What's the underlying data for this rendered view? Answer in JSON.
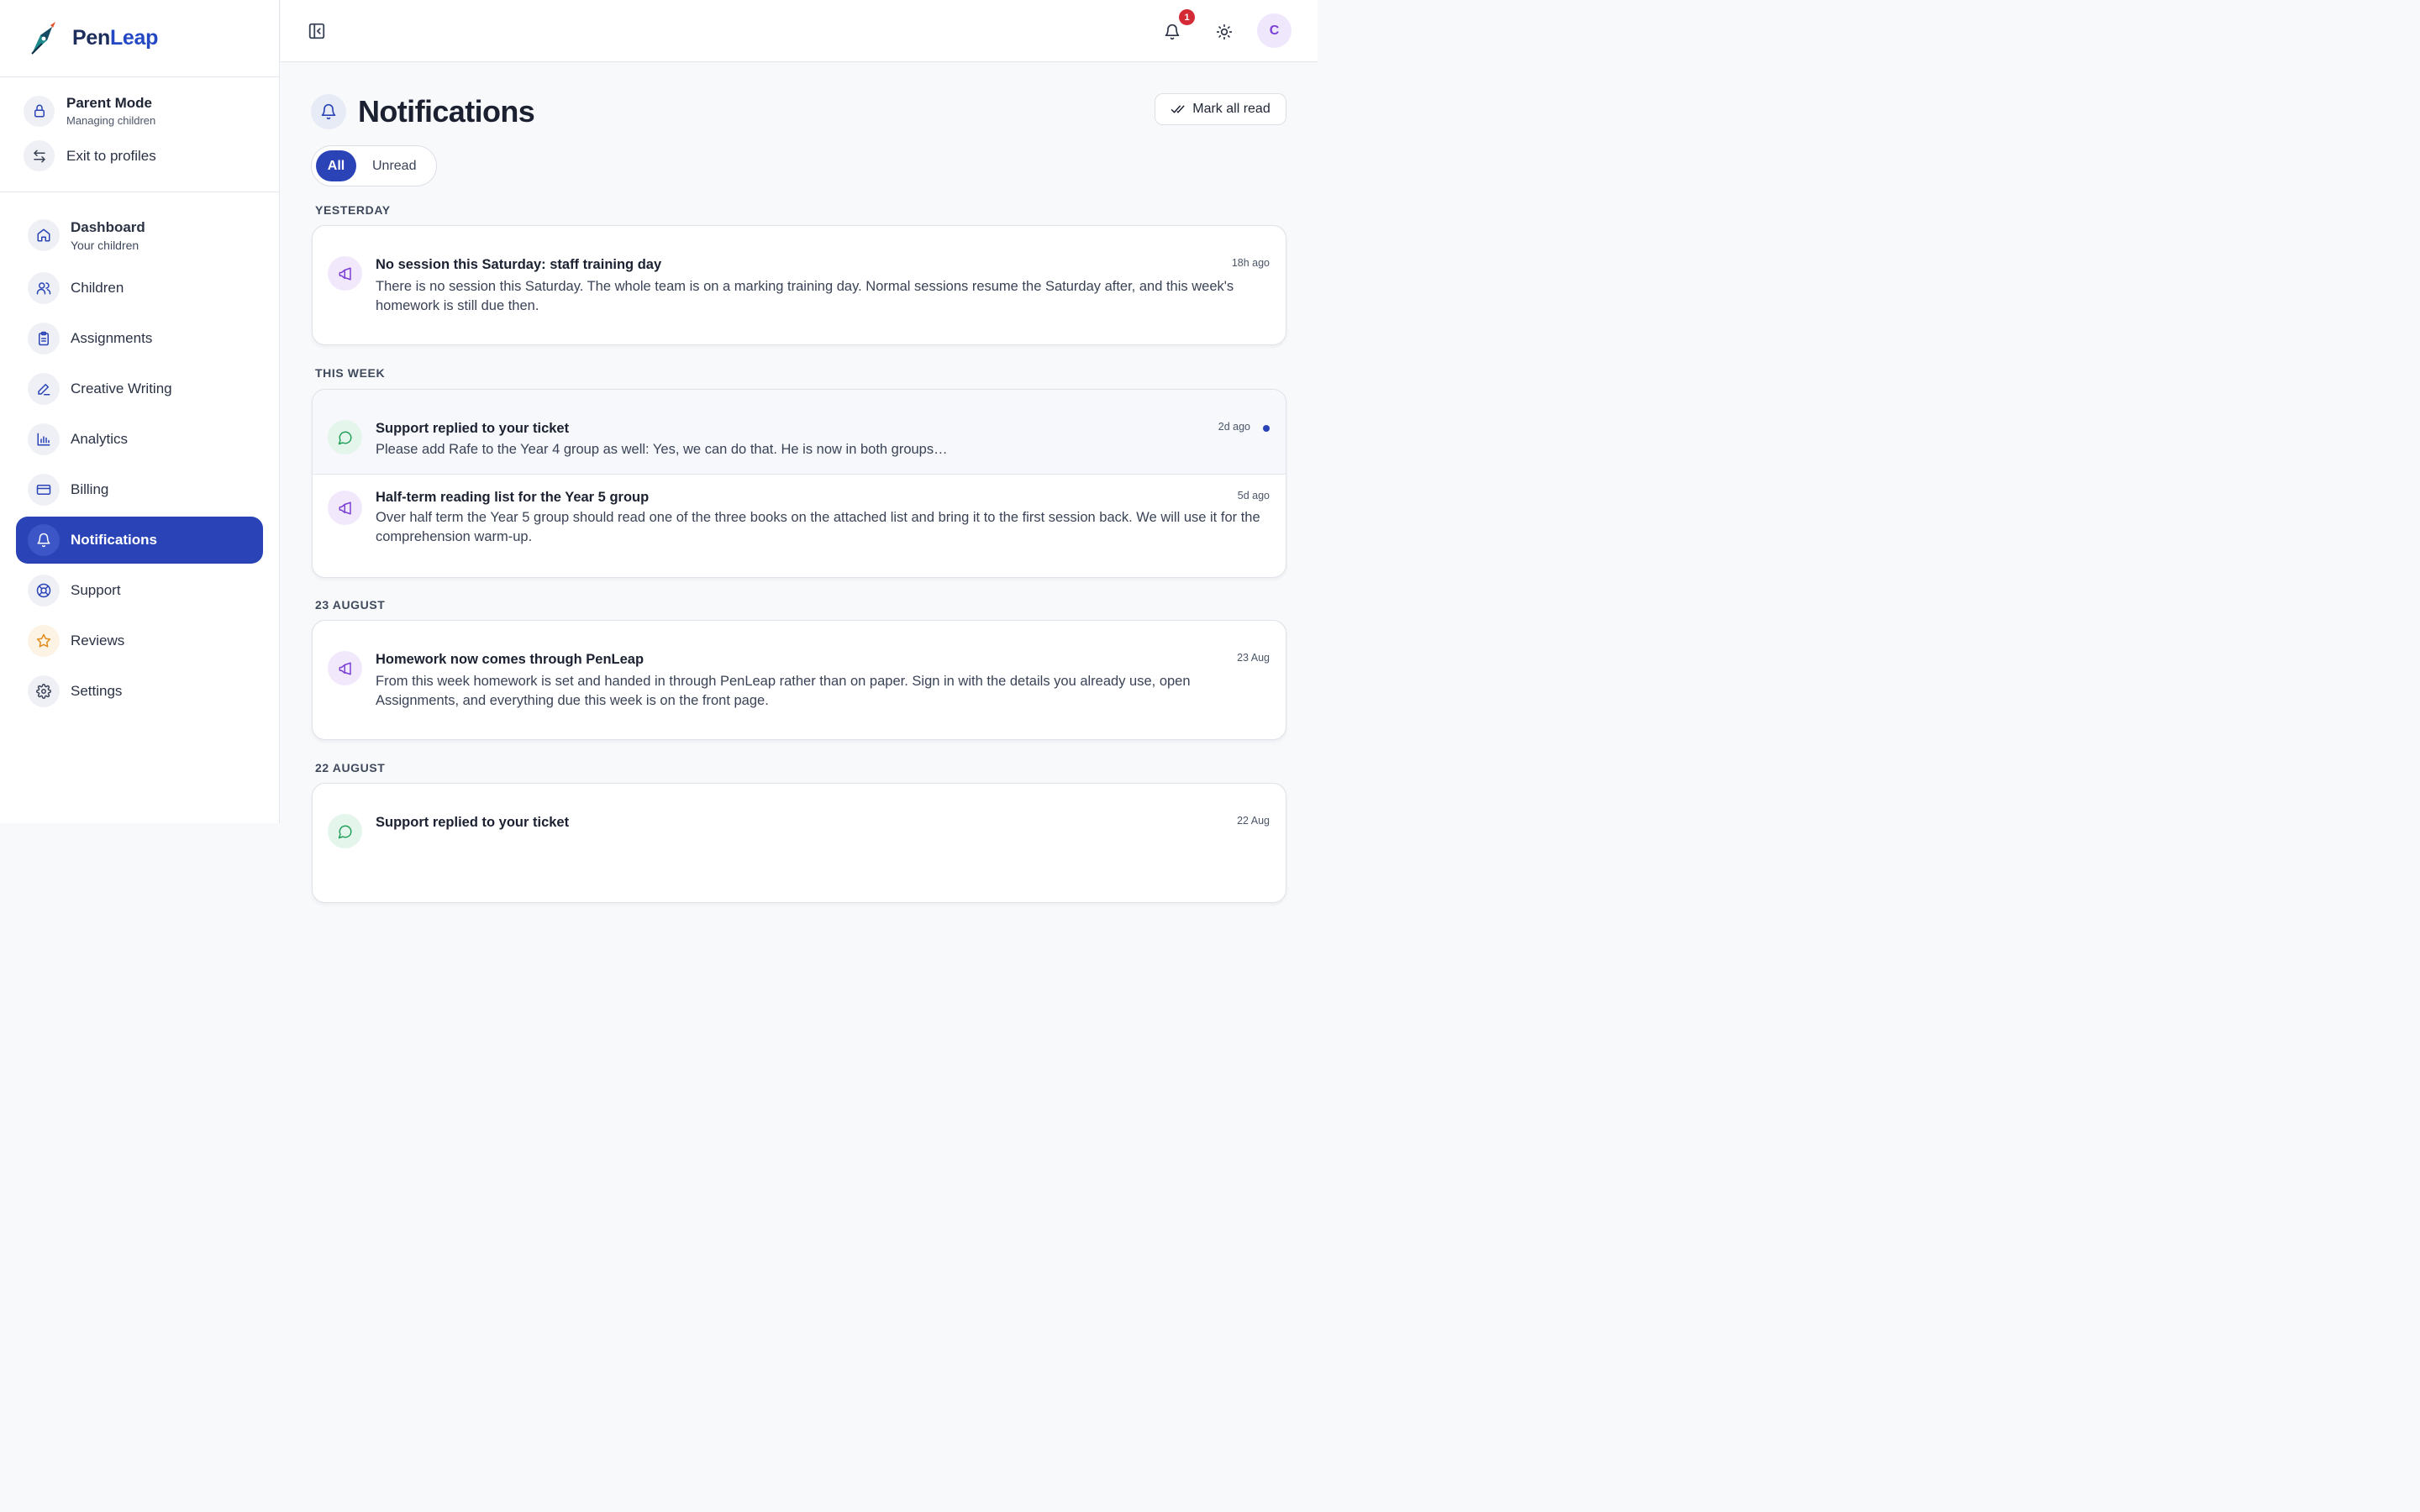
{
  "brand": {
    "name_part1": "Pen",
    "name_part2": "Leap"
  },
  "mode": {
    "title": "Parent Mode",
    "subtitle": "Managing children",
    "exit_label": "Exit to profiles"
  },
  "nav": {
    "dashboard": {
      "label": "Dashboard",
      "sub": "Your children"
    },
    "children": "Children",
    "assignments": "Assignments",
    "creative_writing": "Creative Writing",
    "analytics": "Analytics",
    "billing": "Billing",
    "notifications": "Notifications",
    "support": "Support",
    "reviews": "Reviews",
    "settings": "Settings"
  },
  "topbar": {
    "notification_count": "1",
    "avatar_initial": "C"
  },
  "page": {
    "title": "Notifications",
    "mark_all_label": "Mark all read",
    "filter_all": "All",
    "filter_unread": "Unread"
  },
  "sections": [
    {
      "label": "Yesterday",
      "items": [
        {
          "type": "announce",
          "title": "No session this Saturday: staff training day",
          "body": "There is no session this Saturday. The whole team is on a marking training day. Normal sessions resume the Saturday after, and this week's homework is still due then.",
          "time": "18h ago",
          "unread": false
        }
      ]
    },
    {
      "label": "This week",
      "items": [
        {
          "type": "support",
          "title": "Support replied to your ticket",
          "body": "Please add Rafe to the Year 4 group as well: Yes, we can do that. He is now in both groups…",
          "time": "2d ago",
          "unread": true
        },
        {
          "type": "announce",
          "title": "Half-term reading list for the Year 5 group",
          "body": "Over half term the Year 5 group should read one of the three books on the attached list and bring it to the first session back. We will use it for the comprehension warm-up.",
          "time": "5d ago",
          "unread": false
        }
      ]
    },
    {
      "label": "23 August",
      "items": [
        {
          "type": "announce",
          "title": "Homework now comes through PenLeap",
          "body": "From this week homework is set and handed in through PenLeap rather than on paper. Sign in with the details you already use, open Assignments, and everything due this week is on the front page.",
          "time": "23 Aug",
          "unread": false
        }
      ]
    },
    {
      "label": "22 August",
      "items": [
        {
          "type": "support",
          "title": "Support replied to your ticket",
          "body": "",
          "time": "22 Aug",
          "unread": false
        }
      ]
    }
  ],
  "colors": {
    "primary": "#2a44b8",
    "badge": "#d42a35",
    "announce_icon": "#7b3fd6",
    "support_icon": "#22a05a",
    "star_icon": "#e08a1a"
  }
}
